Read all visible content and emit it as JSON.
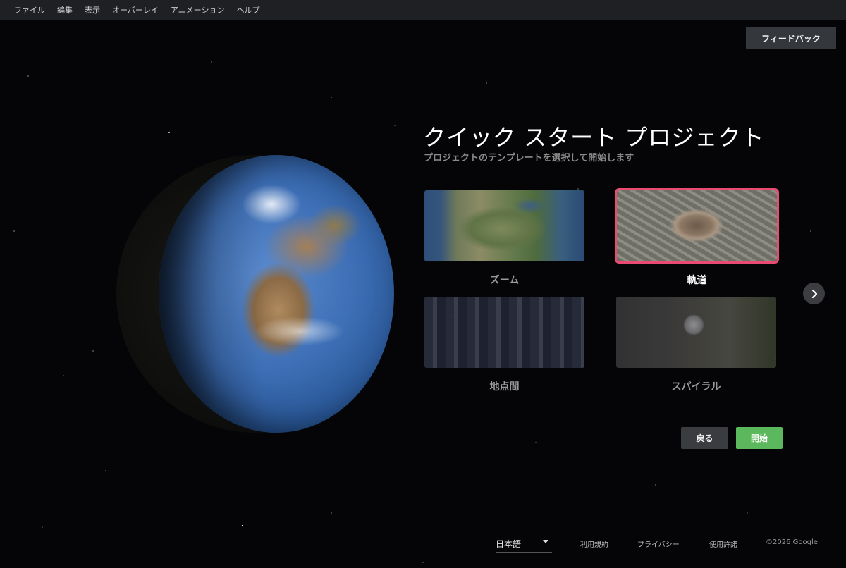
{
  "menu": {
    "items": [
      "ファイル",
      "編集",
      "表示",
      "オーバーレイ",
      "アニメーション",
      "ヘルプ"
    ]
  },
  "feedback_label": "フィードバック",
  "panel": {
    "title": "クイック スタート プロジェクト",
    "subtitle": "プロジェクトのテンプレートを選択して開始します",
    "templates": [
      {
        "label": "ズーム",
        "selected": false
      },
      {
        "label": "軌道",
        "selected": true
      },
      {
        "label": "地点間",
        "selected": false
      },
      {
        "label": "スパイラル",
        "selected": false
      }
    ],
    "next_icon": "chevron-right-icon",
    "back_label": "戻る",
    "start_label": "開始"
  },
  "colors": {
    "selected_outline": "#ea4b72",
    "start_button": "#5cb85c"
  },
  "footer": {
    "language": "日本語",
    "terms": "利用規約",
    "privacy": "プライバシー",
    "license": "使用許諾",
    "copyright": "©2026 Google"
  }
}
